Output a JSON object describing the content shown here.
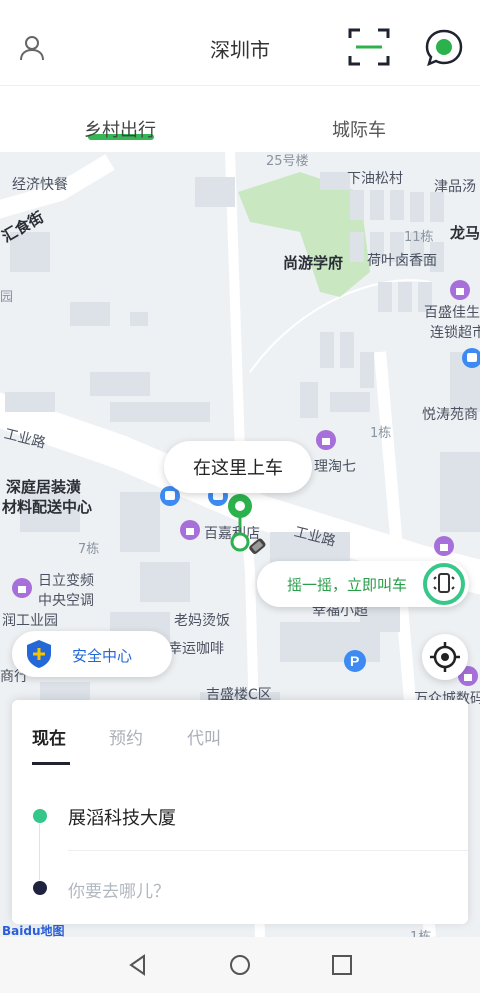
{
  "header": {
    "city": "深圳市",
    "user_icon": "user-icon",
    "scan_icon": "scan-icon",
    "message_icon": "message-icon"
  },
  "tabs": [
    {
      "label": "乡村出行",
      "active": true
    },
    {
      "label": "城际车",
      "active": false
    }
  ],
  "map": {
    "labels": {
      "l1": "经济快餐",
      "l2": "25号楼",
      "l3": "下油松村",
      "l4": "津品汤",
      "l5": "龙马",
      "l6": "11栋",
      "l7": "尚游学府",
      "l8": "荷叶卤香面",
      "l9": "百盛佳生",
      "l10": "连锁超市",
      "l11": "悦涛苑商",
      "l12": "1栋",
      "l13": "工业路",
      "l14": "理淘七",
      "l15": "深庭居装潢",
      "l16": "材料配送中心",
      "l17": "百嘉利店",
      "l18": "工业路",
      "l19": "7栋",
      "l20": "日立变频",
      "l21": "中央空调",
      "l22": "润工业园",
      "l23": "老妈烫饭",
      "l24": "幸福小超",
      "l25": "幸运咖啡",
      "l26": "吉盛楼C区",
      "l27": "万众城数码",
      "l28": "商行",
      "l29": "汇食街",
      "l30": "园",
      "l31": "1栋"
    },
    "pickup_bubble": "在这里上车",
    "shake_button": "摇一摇，立即叫车",
    "safety_center": "安全中心",
    "baidu_logo": "Baidu地图"
  },
  "card": {
    "modes": [
      {
        "label": "现在",
        "active": true
      },
      {
        "label": "预约",
        "active": false
      },
      {
        "label": "代叫",
        "active": false
      }
    ],
    "start": "展滔科技大厦",
    "destination_placeholder": "你要去哪儿？"
  },
  "colors": {
    "accent": "#2bb24c",
    "start_dot": "#35c78a",
    "dest_dot": "#1f2340",
    "safety_blue": "#2467d8"
  },
  "navbar": {
    "back_icon": "back-triangle-icon",
    "home_icon": "home-circle-icon",
    "recent_icon": "recent-square-icon"
  }
}
